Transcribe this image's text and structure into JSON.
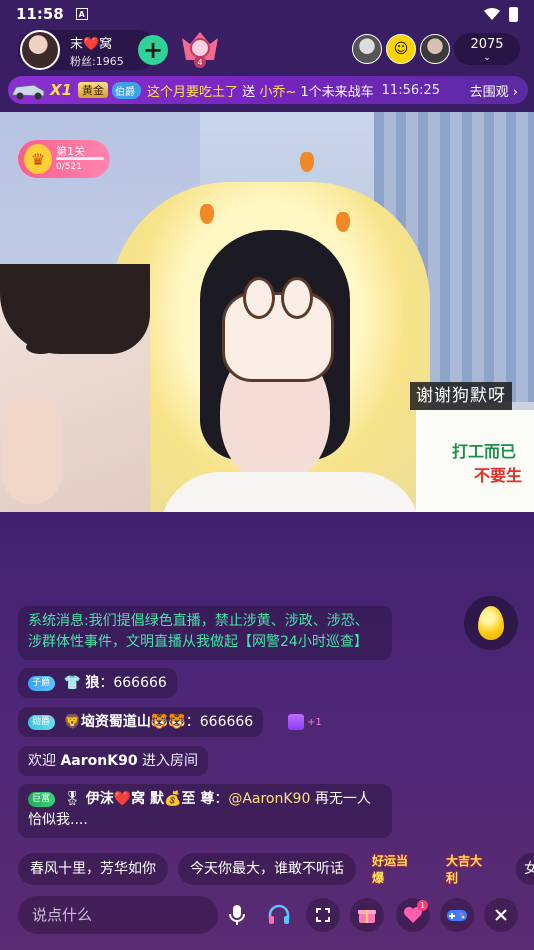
{
  "status_bar": {
    "time": "11:58",
    "notif_letter": "A"
  },
  "host": {
    "name": "末❤️窝",
    "fans": "粉丝:1965",
    "follow_symbol": "+",
    "rank_level": "4"
  },
  "viewers": {
    "count": "2075",
    "v2_face": "☺"
  },
  "banner": {
    "multiplier": "X1",
    "gold_badge": "黄金",
    "peer_badge": "伯爵",
    "text_main": "这个月要吃土了",
    "text_send": "送",
    "recipient": "小乔~",
    "gift": "1个未来战车",
    "time": "11:56:25",
    "action": "去围观"
  },
  "level_badge": {
    "name": "第1关",
    "progress": "0/521"
  },
  "captions": {
    "thanks": "谢谢狗默呀",
    "sign_line1": "打工而已",
    "sign_line2": "不要生"
  },
  "chat": {
    "system": "系统消息:我们提倡绿色直播，禁止涉黄、涉政、涉恐、涉群体性事件，文明直播从我做起【网警24小时巡查】",
    "msg_a": {
      "tag": "子爵",
      "sender": "狼",
      "text": "666666"
    },
    "msg_b": {
      "tag": "勋爵",
      "sender": "🦁垴资蜀道山🐯🐯",
      "text": "666666"
    },
    "like_count": "+1",
    "msg_c": {
      "prefix": "欢迎",
      "user": "AaronK90",
      "suffix": "进入房间"
    },
    "msg_d": {
      "tag": "巨富",
      "sender": "伊沫❤️窝 默💰至 尊",
      "mention": "@AaronK90",
      "text": "再无一人恰似我...."
    }
  },
  "quick_phrases": [
    "春风十里，芳华如你",
    "今天你最大，谁敢不听话",
    "好运当爆",
    "大吉大利",
    "女"
  ],
  "bottom_bar": {
    "placeholder": "说点什么",
    "heart_badge": "1"
  }
}
